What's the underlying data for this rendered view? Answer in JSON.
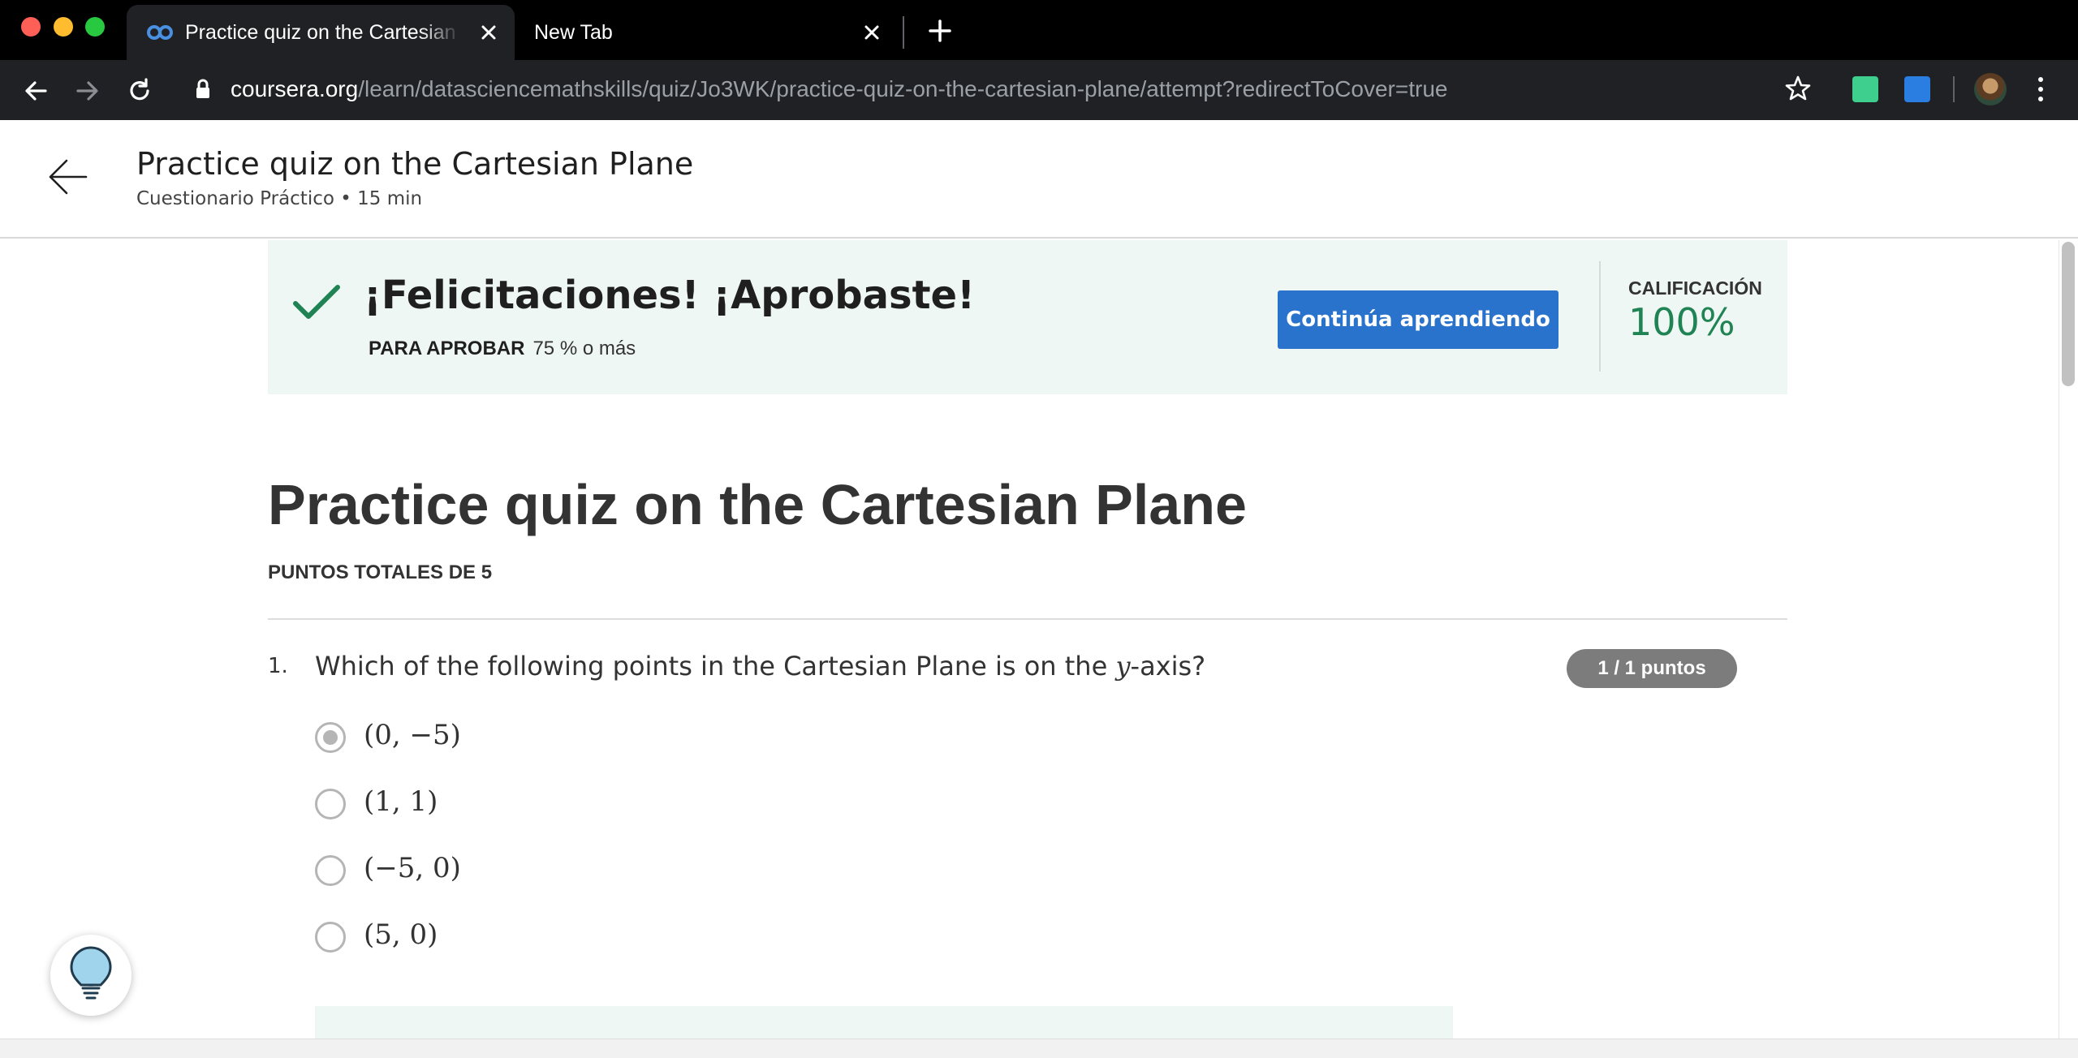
{
  "browser": {
    "tabs": [
      {
        "title": "Practice quiz on the Cartesian Pl",
        "active": true,
        "favicon": "coursera-logo-icon"
      },
      {
        "title": "New Tab",
        "active": false
      }
    ],
    "url_host": "coursera.org",
    "url_path": "/learn/datasciencemathskills/quiz/Jo3WK/practice-quiz-on-the-cartesian-plane/attempt?redirectToCover=true"
  },
  "header": {
    "title": "Practice quiz on the Cartesian Plane",
    "meta": "Cuestionario Práctico • 15 min"
  },
  "banner": {
    "title": "¡Felicitaciones! ¡Aprobaste!",
    "pass_label": "PARA APROBAR",
    "pass_value": "75 % o más",
    "button": "Continúa aprendiendo",
    "grade_label": "CALIFICACIÓN",
    "grade_value": "100%",
    "accent_color": "#1f8354",
    "button_color": "#2a73cc"
  },
  "quiz": {
    "title": "Practice quiz on the Cartesian Plane",
    "total_points": "PUNTOS TOTALES DE 5",
    "questions": [
      {
        "number": "1.",
        "text_before": "Which of the following points in the Cartesian Plane is on the ",
        "text_var": "y",
        "text_after": "-axis?",
        "points": "1 / 1 puntos",
        "options": [
          {
            "label": "(0, −5)",
            "selected": true
          },
          {
            "label": "(1, 1)",
            "selected": false
          },
          {
            "label": "(−5, 0)",
            "selected": false
          },
          {
            "label": "(5, 0)",
            "selected": false
          }
        ]
      }
    ]
  },
  "icons": {
    "help": "lightbulb-icon",
    "back": "arrow-left-icon",
    "success": "checkmark-icon"
  }
}
